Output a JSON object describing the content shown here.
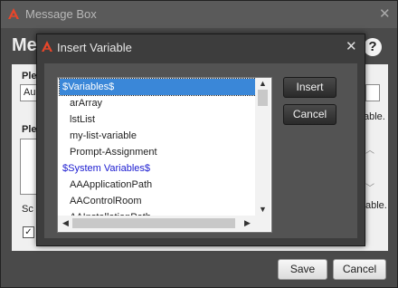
{
  "outer_window": {
    "title": "Message Box",
    "heading": "Me",
    "help_glyph": "?",
    "labels": [
      "Ple",
      "Ple",
      "Sc"
    ],
    "input_value": "Au",
    "text_right_1": "able.",
    "text_right_2": "able.",
    "check_glyph": "✓"
  },
  "footer": {
    "save_label": "Save",
    "cancel_label": "Cancel"
  },
  "dialog": {
    "title": "Insert Variable",
    "close_glyph": "✕",
    "insert_label": "Insert",
    "cancel_label": "Cancel",
    "items": [
      {
        "label": "$Variables$",
        "type": "header",
        "selected": true
      },
      {
        "label": "arArray",
        "type": "child"
      },
      {
        "label": "lstList",
        "type": "child"
      },
      {
        "label": "my-list-variable",
        "type": "child"
      },
      {
        "label": "Prompt-Assignment",
        "type": "child"
      },
      {
        "label": "$System Variables$",
        "type": "header"
      },
      {
        "label": "AAApplicationPath",
        "type": "child"
      },
      {
        "label": "AAControlRoom",
        "type": "child"
      },
      {
        "label": "AAInstallationPath",
        "type": "child"
      }
    ]
  },
  "colors": {
    "accent": "#e8462a",
    "selection": "#3a87d8",
    "header_text": "#1a1ad0"
  }
}
